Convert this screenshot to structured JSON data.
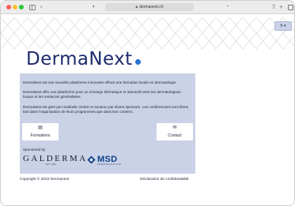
{
  "browser": {
    "url": "dermanext.ch",
    "icons": [
      "sidebar-icon",
      "back-icon",
      "privacy-shield-icon",
      "lock-icon",
      "reader-icon",
      "share-icon",
      "new-tab-icon",
      "tab-overview-icon"
    ]
  },
  "header": {
    "brand_part1": "Derma",
    "brand_part2": "Next",
    "brand_color": "#1d2b6b",
    "brand_dot_color": "#2b6fcf",
    "language_selector": "fr ▾"
  },
  "main": {
    "panel_color": "#c9d2e6",
    "paragraphs": [
      "DermaNext est une nouvelle plateforme innovante offrant une formation locale en dermatologie.",
      "DermaNext offre une plateforme pour un échange thématique et interactif entre les dermatologues locaux et les médecins généralistes.",
      "DermaNext est géré par mediaslic GmbH et soutenu par divers sponsors. Les conférenciers sont libres tant dans l'organisation de leurs programmes que dans leur contenu."
    ],
    "cards": [
      {
        "label": "Formations",
        "icon": "book-icon"
      },
      {
        "label": "Contact",
        "icon": "envelope-icon"
      }
    ],
    "sponsored_label": "Sponsored by",
    "sponsors": {
      "galderma": "GALDERMA",
      "galderma_tagline": "EST 1981",
      "msd": "MSD",
      "msd_tagline": "INVENTING FOR LIFE",
      "msd_color": "#0f3f8a"
    }
  },
  "footer": {
    "copyright": "Copyright © 2022 Dermanext",
    "privacy_link": "Déclaration de confidentialité"
  }
}
